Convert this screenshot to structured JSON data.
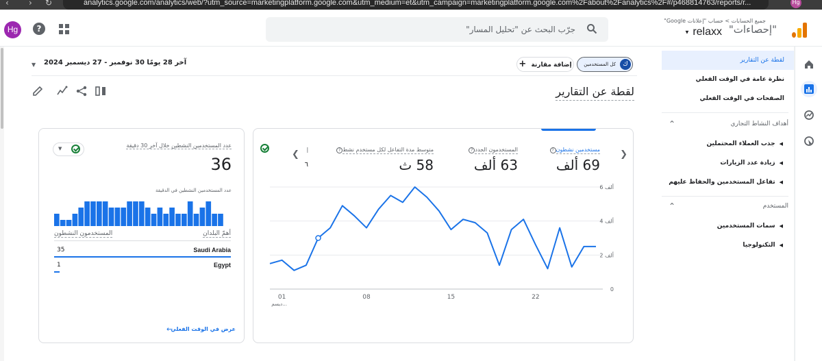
{
  "browser": {
    "url": "analytics.google.com/analytics/web/?utm_source=marketingplatform.google.com&utm_medium=et&utm_campaign=marketingplatform.google.com%2Fabout%2Fanalytics%2F#/p468814763/reports/r...",
    "profile": "Hg"
  },
  "header": {
    "avatar": "Hg",
    "search_placeholder": "جرّب البحث عن \"تحليل المسار\"",
    "breadcrumb": "جميع الحسابات  >  حساب \"إعلانات Google\"",
    "property": "relaxx",
    "product": "\"إحصاءات\"",
    "icons": [
      "help-icon",
      "apps-icon",
      "search-icon",
      "analytics-logo"
    ]
  },
  "nav": {
    "items": [
      {
        "label": "لقطة عن التقارير",
        "active": true
      },
      {
        "label": "نظرة عامة في الوقت الفعلي"
      },
      {
        "label": "الصفحات في الوقت الفعلي"
      }
    ],
    "section1": {
      "title": "أهداف النشاط التجاري",
      "items": [
        "جذب العملاء المحتملين",
        "زيادة عدد الزيارات",
        "تفاعل المستخدمين والحفاظ عليهم"
      ]
    },
    "section2": {
      "title": "المستخدم",
      "items": [
        "سمات المستخدمين",
        "التكنولوجيا"
      ]
    }
  },
  "toolbar": {
    "date_range": "آخر 28 يومًا  30 نوفمبر - 27 ديسمبر 2024",
    "compare": "إضافة مقارنة",
    "segment_chip": "كل المستخدمين",
    "segment_letter": "ك",
    "title": "لقطة عن التقارير"
  },
  "metrics": [
    {
      "label": "مستخدمين نشطون",
      "value": "69 ألف",
      "active": true
    },
    {
      "label": "المستخدمون الجدد",
      "value": "63 ألف"
    },
    {
      "label": "متوسط مدة التفاعل لكل مستخدم نشط",
      "value": "58 ث"
    },
    {
      "label": "إ",
      "value": "٦"
    }
  ],
  "chart_data": {
    "type": "line",
    "title": "",
    "xlabel": "",
    "ylabel": "",
    "x_ticks": [
      "01\nديسم...",
      "08",
      "15",
      "22"
    ],
    "y_ticks": [
      "0",
      "2 ألف",
      "4 ألف",
      "6 ألف"
    ],
    "ylim": [
      0,
      6000
    ],
    "color": "#1a73e8",
    "series": [
      {
        "x": [
          "Nov 30",
          "Dec 1",
          "Dec 2",
          "Dec 3",
          "Dec 4",
          "Dec 5",
          "Dec 6",
          "Dec 7",
          "Dec 8",
          "Dec 9",
          "Dec 10",
          "Dec 11",
          "Dec 12",
          "Dec 13",
          "Dec 14",
          "Dec 15",
          "Dec 16",
          "Dec 17",
          "Dec 18",
          "Dec 19",
          "Dec 20",
          "Dec 21",
          "Dec 22",
          "Dec 23",
          "Dec 24",
          "Dec 25",
          "Dec 26",
          "Dec 27"
        ],
        "values": [
          1500,
          1700,
          1100,
          1400,
          3000,
          3600,
          4900,
          4300,
          3600,
          4700,
          5500,
          5100,
          6000,
          5400,
          4600,
          3500,
          4100,
          3900,
          3300,
          1400,
          3500,
          4100,
          2600,
          1200,
          3600,
          1300,
          2500,
          2500
        ]
      }
    ]
  },
  "realtime": {
    "title": "عدد المستخدمين النشطين خلال آخر 30 دقيقة",
    "value": "36",
    "per_minute_label": "عدد المستخدمين النشطين في الدقيقة",
    "per_minute_values": [
      2,
      1,
      1,
      2,
      3,
      4,
      4,
      4,
      4,
      3,
      3,
      3,
      4,
      4,
      4,
      3,
      2,
      3,
      2,
      3,
      2,
      2,
      4,
      2,
      3,
      4,
      2,
      2
    ],
    "col_country": "أهمّ البلدان",
    "col_users": "المستخدمون النشطون",
    "rows": [
      {
        "country": "Saudi Arabia",
        "users": "35",
        "share": 1.0
      },
      {
        "country": "Egypt",
        "users": "1",
        "share": 0.03
      }
    ],
    "link": "عرض في الوقت الفعلي"
  }
}
